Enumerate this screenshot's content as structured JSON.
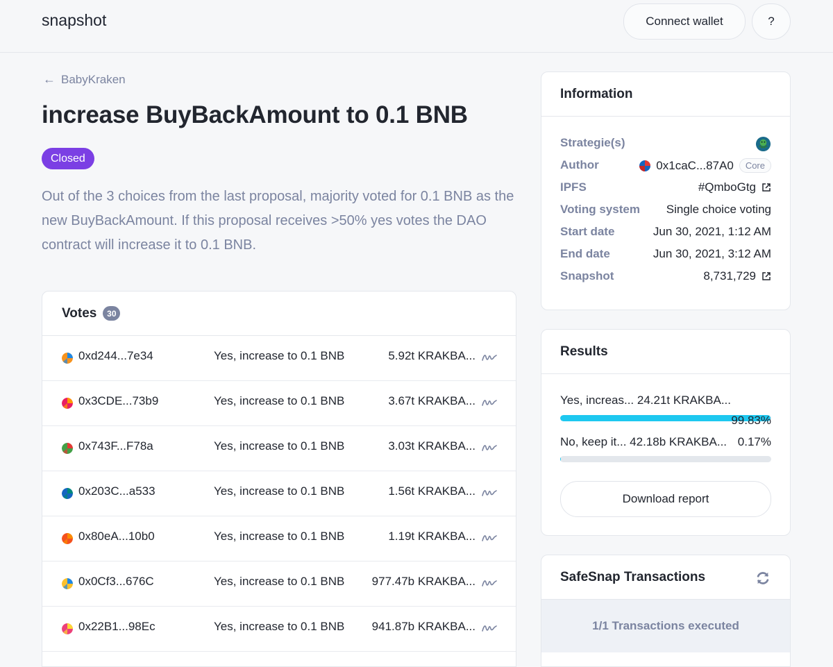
{
  "header": {
    "brand": "snapshot",
    "connect_label": "Connect wallet",
    "help_label": "?"
  },
  "proposal": {
    "back_label": "BabyKraken",
    "title": "increase BuyBackAmount to 0.1 BNB",
    "status": "Closed",
    "description": "Out of the 3 choices from the last proposal, majority voted for 0.1 BNB as the new BuyBackAmount. If this proposal receives >50% yes votes the DAO contract will increase it to 0.1 BNB."
  },
  "votes": {
    "title": "Votes",
    "count": "30",
    "rows": [
      {
        "voter": "0xd244...7e34",
        "choice": "Yes, increase to 0.1 BNB",
        "power": "5.92t KRAKBA...",
        "avatar_colors": [
          "#f7931e",
          "#1e88e5"
        ]
      },
      {
        "voter": "0x3CDE...73b9",
        "choice": "Yes, increase to 0.1 BNB",
        "power": "3.67t KRAKBA...",
        "avatar_colors": [
          "#e91e63",
          "#ff9800"
        ]
      },
      {
        "voter": "0x743F...F78a",
        "choice": "Yes, increase to 0.1 BNB",
        "power": "3.03t KRAKBA...",
        "avatar_colors": [
          "#43a047",
          "#e53935"
        ]
      },
      {
        "voter": "0x203C...a533",
        "choice": "Yes, increase to 0.1 BNB",
        "power": "1.56t KRAKBA...",
        "avatar_colors": [
          "#1565c0",
          "#00897b"
        ]
      },
      {
        "voter": "0x80eA...10b0",
        "choice": "Yes, increase to 0.1 BNB",
        "power": "1.19t KRAKBA...",
        "avatar_colors": [
          "#f4511e",
          "#fb8c00"
        ]
      },
      {
        "voter": "0x0Cf3...676C",
        "choice": "Yes, increase to 0.1 BNB",
        "power": "977.47b KRAKBA...",
        "avatar_colors": [
          "#fbc02d",
          "#1e88e5"
        ]
      },
      {
        "voter": "0x22B1...98Ec",
        "choice": "Yes, increase to 0.1 BNB",
        "power": "941.87b KRAKBA...",
        "avatar_colors": [
          "#ec407a",
          "#fdd835"
        ]
      }
    ]
  },
  "information": {
    "title": "Information",
    "strategies_label": "Strategie(s)",
    "author_label": "Author",
    "author_value": "0x1caC...87A0",
    "author_tag": "Core",
    "ipfs_label": "IPFS",
    "ipfs_value": "#QmboGtg",
    "voting_system_label": "Voting system",
    "voting_system_value": "Single choice voting",
    "start_label": "Start date",
    "start_value": "Jun 30, 2021, 1:12 AM",
    "end_label": "End date",
    "end_value": "Jun 30, 2021, 3:12 AM",
    "snapshot_label": "Snapshot",
    "snapshot_value": "8,731,729"
  },
  "results": {
    "title": "Results",
    "items": [
      {
        "label": "Yes, increas... 24.21t KRAKBA...",
        "percent_label": "99.83%",
        "percent": 99.83
      },
      {
        "label": "No, keep it... 42.18b KRAKBA...",
        "percent_label": "0.17%",
        "percent": 0.17
      }
    ],
    "download_label": "Download report"
  },
  "safesnap": {
    "title": "SafeSnap Transactions",
    "status": "1/1 Transactions executed"
  },
  "colors": {
    "accent_closed": "#7b3fe4",
    "result_bar": "#1ec8f0",
    "muted_text": "#7b84a0"
  }
}
